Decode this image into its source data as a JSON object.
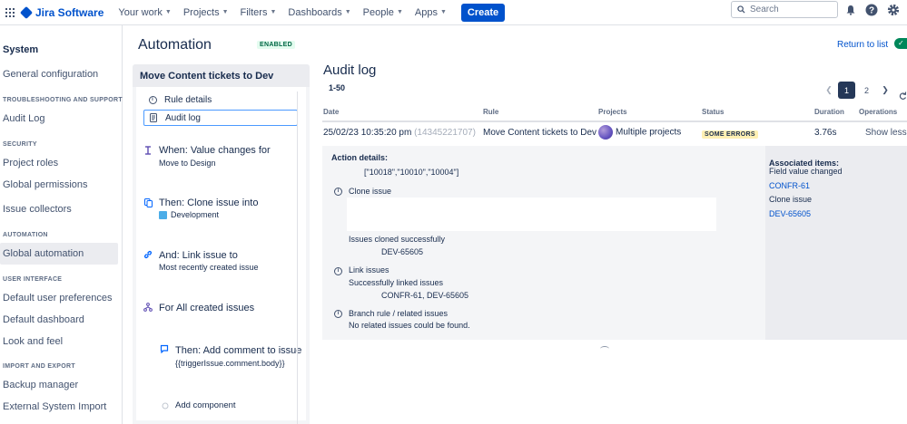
{
  "topnav": {
    "product": "Jira Software",
    "menus": [
      "Your work",
      "Projects",
      "Filters",
      "Dashboards",
      "People",
      "Apps"
    ],
    "create_label": "Create",
    "search_placeholder": "Search"
  },
  "sidebar": {
    "title": "System",
    "general": "General configuration",
    "sections": [
      {
        "heading": "TROUBLESHOOTING AND SUPPORT",
        "items": [
          "Audit Log"
        ]
      },
      {
        "heading": "SECURITY",
        "items": [
          "Project roles",
          "Global permissions",
          "Issue collectors"
        ]
      },
      {
        "heading": "AUTOMATION",
        "items": [
          "Global automation"
        ]
      },
      {
        "heading": "USER INTERFACE",
        "items": [
          "Default user preferences",
          "Default dashboard",
          "Look and feel"
        ]
      },
      {
        "heading": "IMPORT AND EXPORT",
        "items": [
          "Backup manager",
          "External System Import"
        ]
      }
    ],
    "active_item": "Global automation"
  },
  "header": {
    "title": "Automation",
    "status": "ENABLED",
    "return_link": "Return to list",
    "toggle_glyph": "✓"
  },
  "rule": {
    "name": "Move Content tickets to Dev",
    "links": [
      "Rule details",
      "Audit log"
    ],
    "steps": [
      {
        "title": "When: Value changes for",
        "subtitle": "Move to Design",
        "icon": "trigger-icon"
      },
      {
        "title": "Then: Clone issue into",
        "subtitle": "Development",
        "icon": "clone-icon"
      },
      {
        "title": "And: Link issue to",
        "subtitle": "Most recently created issue",
        "icon": "link-icon"
      },
      {
        "title": "For All created issues",
        "subtitle": "",
        "icon": "branch-icon"
      },
      {
        "title": "Then: Add comment to issue",
        "subtitle": "{{triggerIssue.comment.body}}",
        "icon": "comment-icon"
      }
    ],
    "add_component": "Add component"
  },
  "audit": {
    "title": "Audit log",
    "range": "1-50",
    "pages": [
      "1",
      "2"
    ],
    "current_page": "1",
    "columns": [
      "Date",
      "Rule",
      "Projects",
      "Status",
      "Duration",
      "Operations"
    ],
    "row": {
      "date": "25/02/23 10:35:20 pm",
      "id": "(14345221707)",
      "rule": "Move Content tickets to Dev",
      "projects": "Multiple projects",
      "status": "SOME ERRORS",
      "duration": "3.76s",
      "operation": "Show less"
    },
    "details": {
      "action_label": "Action details:",
      "action_values": "[\"10018\",\"10010\",\"10004\"]",
      "clone_title": "Clone issue",
      "clone_result": "Issues cloned successfully",
      "clone_key": "DEV-65605",
      "link_title": "Link issues",
      "link_result": "Successfully linked issues",
      "link_keys": "CONFR-61, DEV-65605",
      "branch_title": "Branch rule / related issues",
      "branch_result": "No related issues could be found."
    },
    "associated": {
      "title": "Associated items:",
      "field_label": "Field value changed",
      "field_key": "CONFR-61",
      "clone_label": "Clone issue",
      "clone_key": "DEV-65605"
    }
  }
}
